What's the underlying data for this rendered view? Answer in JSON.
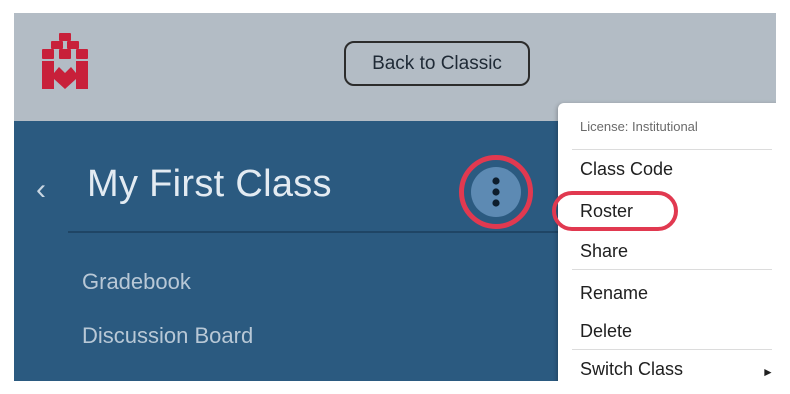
{
  "header": {
    "back_to_classic_label": "Back to Classic",
    "logo_color": "#c8203a"
  },
  "class_panel": {
    "title": "My First Class",
    "nav_links": [
      "Gradebook",
      "Discussion Board"
    ],
    "background": "#2b5a80"
  },
  "menu": {
    "license": "License: Institutional",
    "items": [
      "Class Code",
      "Roster",
      "Share",
      "Rename",
      "Delete",
      "Switch Class"
    ],
    "highlighted_item": "Roster",
    "highlight_color": "#e13950"
  },
  "icons": {
    "back": "chevron-left-icon",
    "more": "kebab-menu-icon",
    "submenu": "caret-right-icon"
  }
}
